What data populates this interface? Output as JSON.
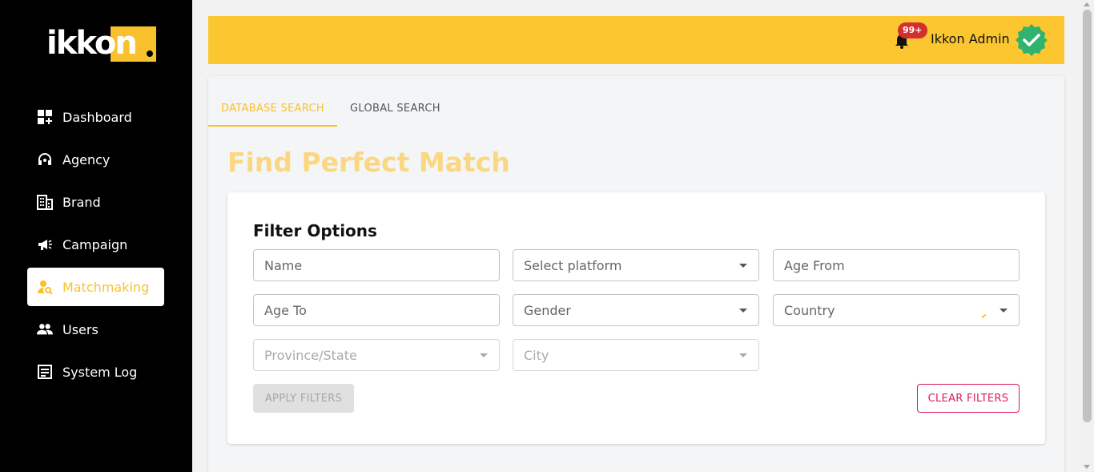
{
  "brand": {
    "logo_text": "ikkon"
  },
  "sidebar": {
    "items": [
      {
        "label": "Dashboard",
        "icon": "dashboard-icon"
      },
      {
        "label": "Agency",
        "icon": "headset-icon"
      },
      {
        "label": "Brand",
        "icon": "building-icon"
      },
      {
        "label": "Campaign",
        "icon": "megaphone-icon"
      },
      {
        "label": "Matchmaking",
        "icon": "person-search-icon",
        "active": true
      },
      {
        "label": "Users",
        "icon": "users-icon"
      },
      {
        "label": "System Log",
        "icon": "log-icon"
      }
    ]
  },
  "topbar": {
    "notification_count": "99+",
    "user_name": "Ikkon Admin"
  },
  "tabs": [
    {
      "label": "DATABASE SEARCH",
      "active": true
    },
    {
      "label": "GLOBAL SEARCH",
      "active": false
    }
  ],
  "page_title": "Find Perfect Match",
  "filters": {
    "title": "Filter Options",
    "name": {
      "placeholder": "Name"
    },
    "platform": {
      "placeholder": "Select platform"
    },
    "age_from": {
      "placeholder": "Age From"
    },
    "age_to": {
      "placeholder": "Age To"
    },
    "gender": {
      "placeholder": "Gender"
    },
    "country": {
      "placeholder": "Country"
    },
    "province": {
      "placeholder": "Province/State"
    },
    "city": {
      "placeholder": "City"
    },
    "apply_label": "APPLY FILTERS",
    "clear_label": "CLEAR FILTERS"
  },
  "colors": {
    "accent": "#f9c12e",
    "topbar": "#fcc630",
    "danger": "#d81b60",
    "badge": "#d32f2f",
    "verified": "#2fb36e"
  }
}
